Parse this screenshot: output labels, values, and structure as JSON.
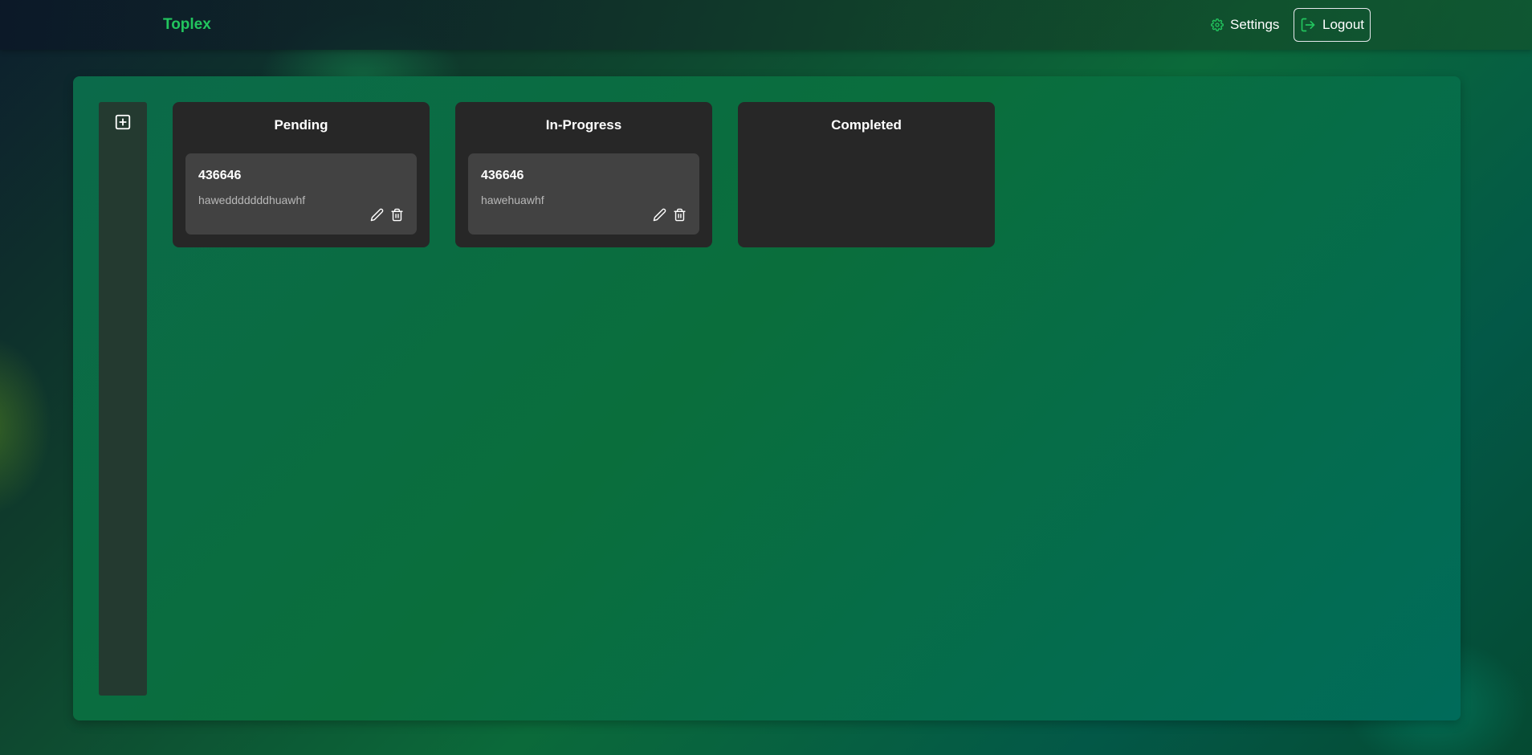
{
  "header": {
    "brand": "Toplex",
    "settings_label": "Settings",
    "logout_label": "Logout",
    "accent_color": "#22c55e"
  },
  "sidebar": {
    "add_icon": "plus-square-icon"
  },
  "columns": [
    {
      "title": "Pending",
      "cards": [
        {
          "title": "436646",
          "description": "hawedddddddhuawhf",
          "actions": [
            "pencil-icon",
            "trash-icon"
          ]
        }
      ]
    },
    {
      "title": "In-Progress",
      "cards": [
        {
          "title": "436646",
          "description": "hawehuawhf",
          "actions": [
            "pencil-icon",
            "trash-icon"
          ]
        }
      ]
    },
    {
      "title": "Completed",
      "cards": []
    }
  ]
}
